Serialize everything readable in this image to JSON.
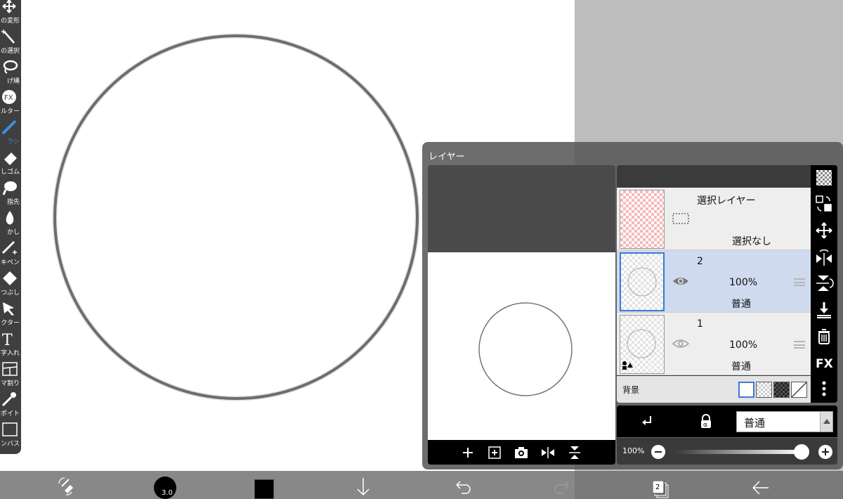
{
  "tools": [
    {
      "icon": "move-transform-icon",
      "label": "の変形",
      "active": false
    },
    {
      "icon": "magic-wand-icon",
      "label": "の選択",
      "active": false
    },
    {
      "icon": "lasso-icon",
      "label": "げ縄",
      "active": false
    },
    {
      "icon": "fx-filter-icon",
      "label": "ルター",
      "active": false
    },
    {
      "icon": "brush-icon",
      "label": "ラシ",
      "active": true
    },
    {
      "icon": "eraser-icon",
      "label": "しゴム",
      "active": false
    },
    {
      "icon": "smudge-icon",
      "label": "指先",
      "active": false
    },
    {
      "icon": "blur-drop-icon",
      "label": "かし",
      "active": false
    },
    {
      "icon": "magic-pen-icon",
      "label": "キペン",
      "active": false
    },
    {
      "icon": "fill-bucket-icon",
      "label": "つぶし",
      "active": false
    },
    {
      "icon": "vector-icon",
      "label": "クター",
      "active": false
    },
    {
      "icon": "text-tool-icon",
      "label": "字入れ",
      "active": false
    },
    {
      "icon": "panel-divide-icon",
      "label": "コマ割り",
      "active": false
    },
    {
      "icon": "eyedropper-icon",
      "label": "ポイト",
      "active": false
    },
    {
      "icon": "canvas-icon",
      "label": "ンバス",
      "active": false
    }
  ],
  "layer_window": {
    "title": "レイヤー",
    "layers": [
      {
        "name": "選択レイヤー",
        "opacity": "",
        "blend": "選択なし",
        "selected": false,
        "visible": true,
        "kind": "selection"
      },
      {
        "name": "2",
        "opacity": "100%",
        "blend": "普通",
        "selected": true,
        "visible": true,
        "kind": "normal"
      },
      {
        "name": "1",
        "opacity": "100%",
        "blend": "普通",
        "selected": false,
        "visible": true,
        "kind": "normal"
      }
    ],
    "background_label": "背景",
    "blend_mode": "普通",
    "opacity_label": "100%",
    "opacity_value": 1.0,
    "right_strip_fx": "FX"
  },
  "bottom_bar": {
    "brush_size": "3.0",
    "color": "#000000",
    "layer_count": "2"
  },
  "colors": {
    "accent": "#3b8fe0",
    "selected_layer": "#cfdaee",
    "toolbar": "#3f3f3f"
  }
}
